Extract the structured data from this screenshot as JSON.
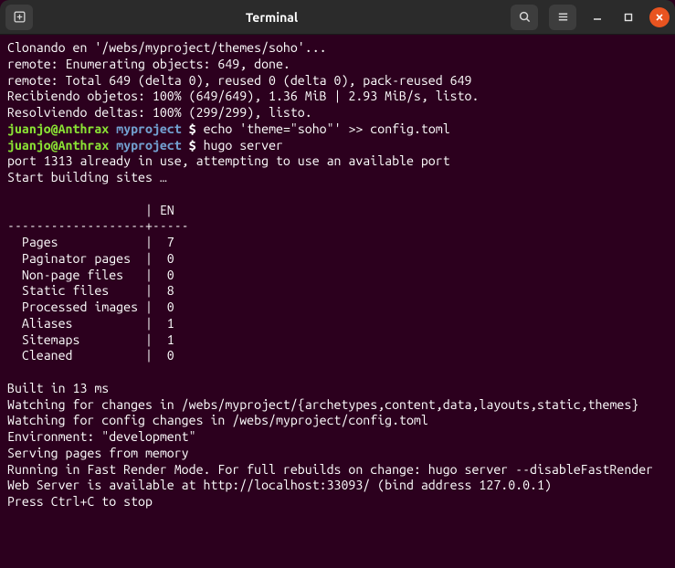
{
  "window": {
    "title": "Terminal"
  },
  "prompt": {
    "userhost": "juanjo@Anthrax",
    "path": "myproject",
    "symbol": "$"
  },
  "lines": {
    "l01": "Clonando en '/webs/myproject/themes/soho'...",
    "l02": "remote: Enumerating objects: 649, done.",
    "l03": "remote: Total 649 (delta 0), reused 0 (delta 0), pack-reused 649",
    "l04": "Recibiendo objetos: 100% (649/649), 1.36 MiB | 2.93 MiB/s, listo.",
    "l05": "Resolviendo deltas: 100% (299/299), listo.",
    "cmd1": "echo 'theme=\"soho\"' >> config.toml",
    "cmd2": "hugo server",
    "l06": "port 1313 already in use, attempting to use an available port",
    "l07": "Start building sites …",
    "l08": "",
    "l09": "                   | EN  ",
    "l10": "-------------------+-----",
    "l11": "  Pages            |  7  ",
    "l12": "  Paginator pages  |  0  ",
    "l13": "  Non-page files   |  0  ",
    "l14": "  Static files     |  8  ",
    "l15": "  Processed images |  0  ",
    "l16": "  Aliases          |  1  ",
    "l17": "  Sitemaps         |  1  ",
    "l18": "  Cleaned          |  0  ",
    "l19": "",
    "l20": "Built in 13 ms",
    "l21": "Watching for changes in /webs/myproject/{archetypes,content,data,layouts,static,themes}",
    "l22": "Watching for config changes in /webs/myproject/config.toml",
    "l23": "Environment: \"development\"",
    "l24": "Serving pages from memory",
    "l25": "Running in Fast Render Mode. For full rebuilds on change: hugo server --disableFastRender",
    "l26": "Web Server is available at http://localhost:33093/ (bind address 127.0.0.1)",
    "l27": "Press Ctrl+C to stop"
  }
}
